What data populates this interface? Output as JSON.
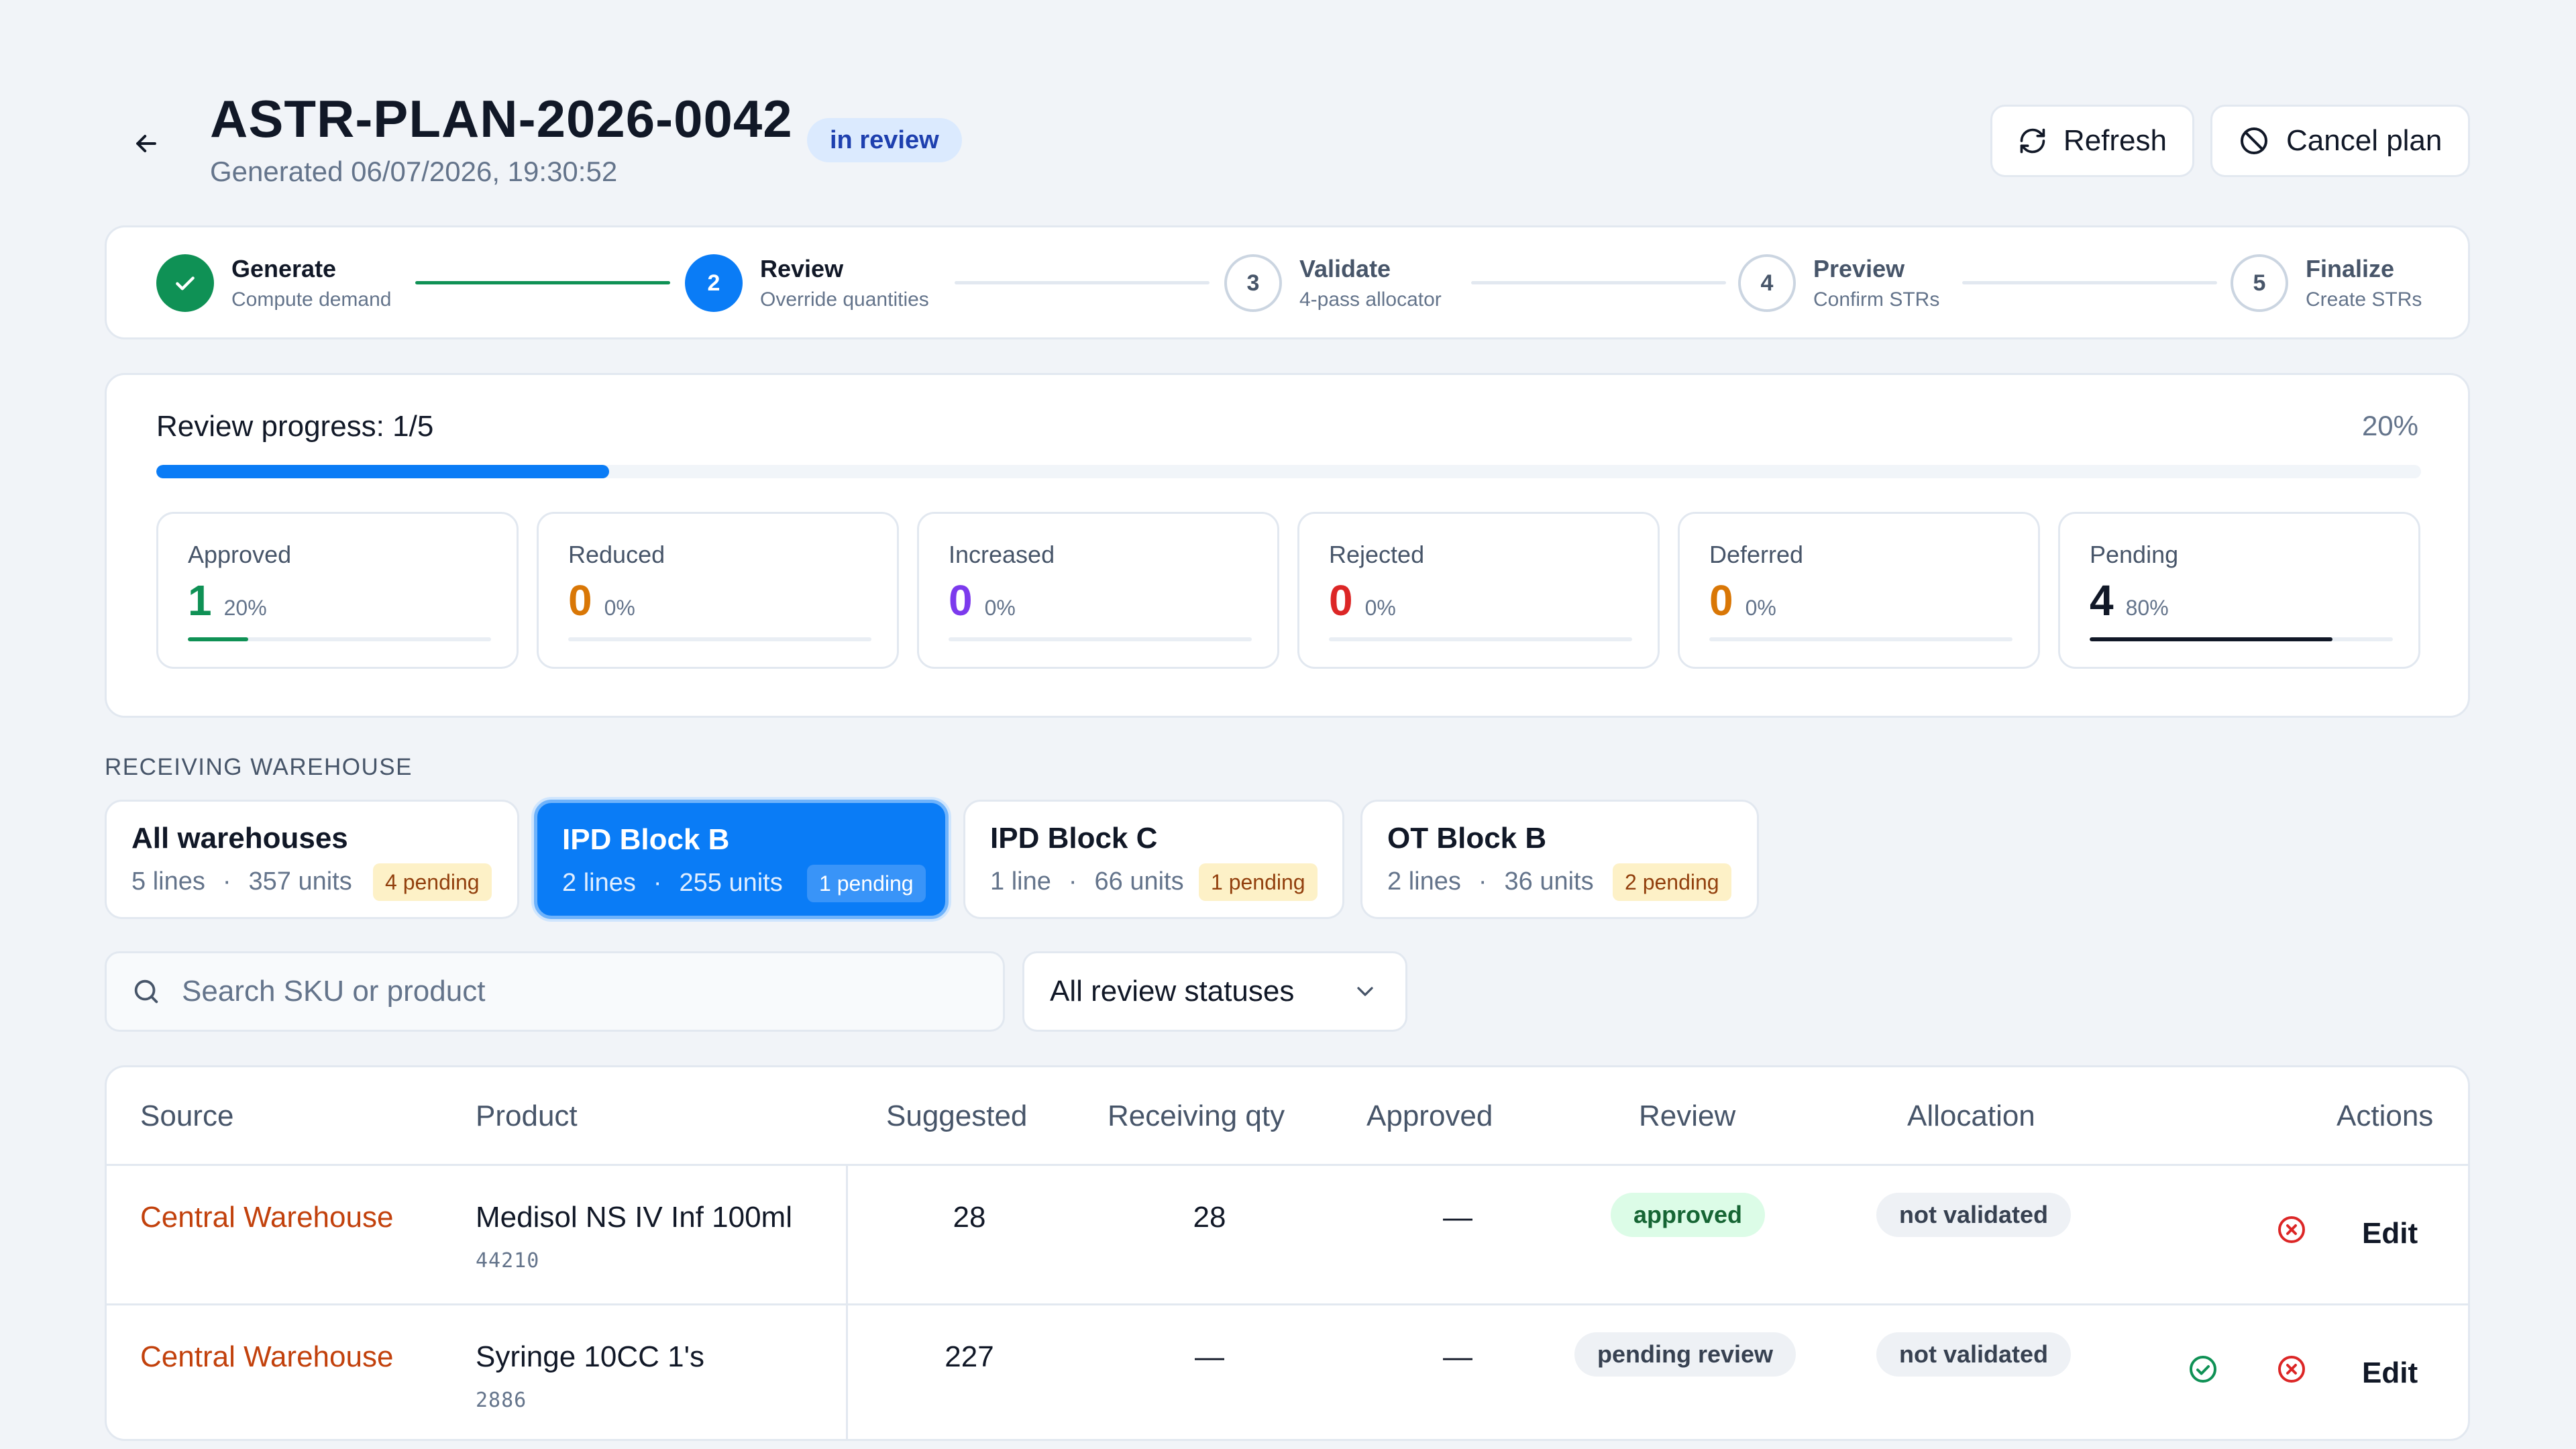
{
  "header": {
    "title": "ASTR-PLAN-2026-0042",
    "generated": "Generated 06/07/2026, 19:30:52",
    "status": "in review",
    "refresh_label": "Refresh",
    "cancel_label": "Cancel plan"
  },
  "steps": [
    {
      "number": "1",
      "label": "Generate",
      "sub": "Compute demand",
      "state": "done"
    },
    {
      "number": "2",
      "label": "Review",
      "sub": "Override quantities",
      "state": "active"
    },
    {
      "number": "3",
      "label": "Validate",
      "sub": "4-pass allocator",
      "state": "todo"
    },
    {
      "number": "4",
      "label": "Preview",
      "sub": "Confirm STRs",
      "state": "todo"
    },
    {
      "number": "5",
      "label": "Finalize",
      "sub": "Create STRs",
      "state": "todo"
    }
  ],
  "progress": {
    "title": "Review progress: 1/5",
    "percent_label": "20%",
    "fraction": 0.2
  },
  "stats": [
    {
      "label": "Approved",
      "value": "1",
      "pct": "20%",
      "fraction": 0.2,
      "color": "#0f9155"
    },
    {
      "label": "Reduced",
      "value": "0",
      "pct": "0%",
      "fraction": 0,
      "color": "#d97706"
    },
    {
      "label": "Increased",
      "value": "0",
      "pct": "0%",
      "fraction": 0,
      "color": "#7c3aed"
    },
    {
      "label": "Rejected",
      "value": "0",
      "pct": "0%",
      "fraction": 0,
      "color": "#dc2626"
    },
    {
      "label": "Deferred",
      "value": "0",
      "pct": "0%",
      "fraction": 0,
      "color": "#d97706"
    },
    {
      "label": "Pending",
      "value": "4",
      "pct": "80%",
      "fraction": 0.8,
      "color": "#111827"
    }
  ],
  "warehouses": {
    "section_label": "RECEIVING WAREHOUSE",
    "items": [
      {
        "name": "All warehouses",
        "lines": "5 lines",
        "units": "357 units",
        "pending": "4 pending",
        "active": false
      },
      {
        "name": "IPD Block B",
        "lines": "2 lines",
        "units": "255 units",
        "pending": "1 pending",
        "active": true
      },
      {
        "name": "IPD Block C",
        "lines": "1 line",
        "units": "66 units",
        "pending": "1 pending",
        "active": false
      },
      {
        "name": "OT Block B",
        "lines": "2 lines",
        "units": "36 units",
        "pending": "2 pending",
        "active": false
      }
    ]
  },
  "filters": {
    "search_placeholder": "Search SKU or product",
    "status_select": "All review statuses"
  },
  "table": {
    "headers": {
      "source": "Source",
      "product": "Product",
      "suggested": "Suggested",
      "receiving": "Receiving qty",
      "approved": "Approved",
      "review": "Review",
      "allocation": "Allocation",
      "actions": "Actions"
    },
    "rows": [
      {
        "source": "Central Warehouse",
        "product": "Medisol NS IV Inf 100ml",
        "sku": "44210",
        "suggested": "28",
        "receiving": "28",
        "approved": "—",
        "review": "approved",
        "allocation": "not validated",
        "edit": "Edit"
      },
      {
        "source": "Central Warehouse",
        "product": "Syringe 10CC 1's",
        "sku": "2886",
        "suggested": "227",
        "receiving": "—",
        "approved": "—",
        "review": "pending review",
        "allocation": "not validated",
        "edit": "Edit"
      }
    ]
  }
}
